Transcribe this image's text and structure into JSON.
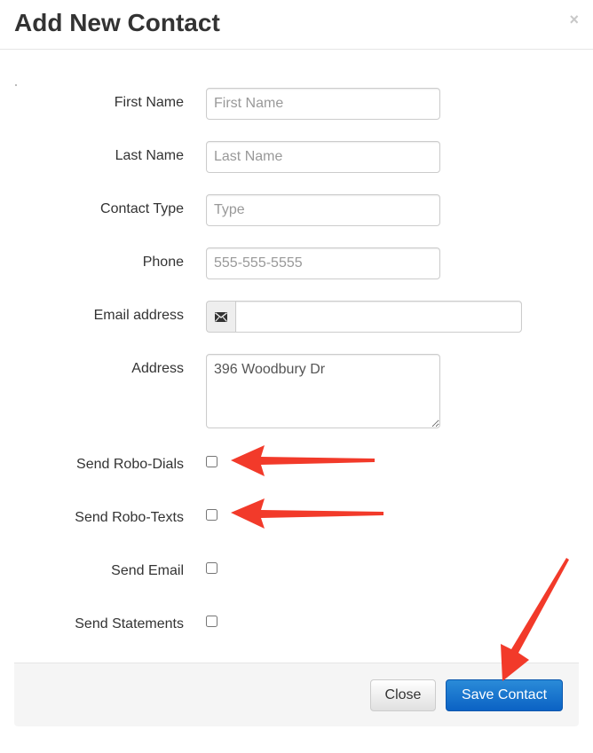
{
  "modal": {
    "title": "Add New Contact",
    "close_symbol": "×"
  },
  "form": {
    "first_name": {
      "label": "First Name",
      "placeholder": "First Name",
      "value": ""
    },
    "last_name": {
      "label": "Last Name",
      "placeholder": "Last Name",
      "value": ""
    },
    "contact_type": {
      "label": "Contact Type",
      "placeholder": "Type",
      "value": ""
    },
    "phone": {
      "label": "Phone",
      "placeholder": "555-555-5555",
      "value": ""
    },
    "email": {
      "label": "Email address",
      "icon": "envelope-icon",
      "value": ""
    },
    "address": {
      "label": "Address",
      "value": "396 Woodbury Dr"
    },
    "send_robo_dials": {
      "label": "Send Robo-Dials",
      "checked": false
    },
    "send_robo_texts": {
      "label": "Send Robo-Texts",
      "checked": false
    },
    "send_email": {
      "label": "Send Email",
      "checked": false
    },
    "send_statements": {
      "label": "Send Statements",
      "checked": false
    }
  },
  "footer": {
    "close_label": "Close",
    "save_label": "Save Contact"
  },
  "colors": {
    "primary": "#0b62c4",
    "annotation_arrow": "#f23a2a"
  }
}
